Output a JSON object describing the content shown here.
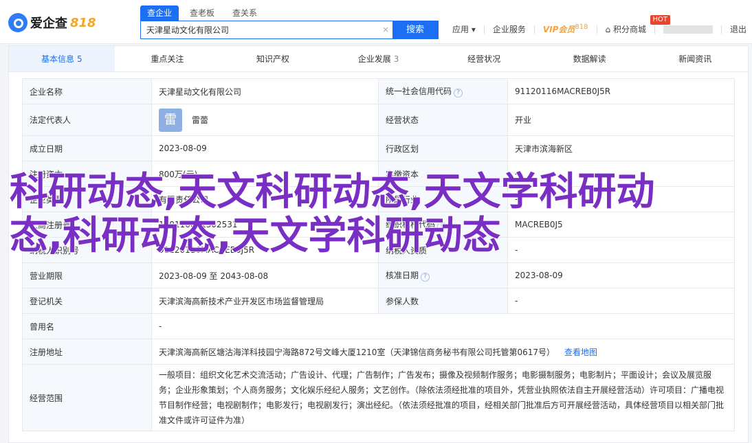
{
  "header": {
    "logo_text": "爱企查",
    "logo_num": "818",
    "search_tabs": [
      "查企业",
      "查老板",
      "查关系"
    ],
    "search_value": "天津星动文化有限公司",
    "search_button": "搜索",
    "nav": {
      "app": "应用",
      "enterprise_service": "企业服务",
      "vip_label": "VIP会员",
      "vip_sub": "818",
      "points_mall": "积分商城",
      "hot_badge": "HOT",
      "logout": "退出"
    }
  },
  "tabs": [
    {
      "label": "基本信息",
      "count": "5"
    },
    {
      "label": "重点关注",
      "count": ""
    },
    {
      "label": "知识产权",
      "count": ""
    },
    {
      "label": "企业发展",
      "count": "3"
    },
    {
      "label": "经营状况",
      "count": ""
    },
    {
      "label": "数据解读",
      "count": ""
    },
    {
      "label": "新闻资讯",
      "count": ""
    }
  ],
  "info": {
    "company_name_label": "企业名称",
    "company_name": "天津星动文化有限公司",
    "credit_code_label": "统一社会信用代码",
    "credit_code": "91120116MACREB0J5R",
    "legal_rep_label": "法定代表人",
    "legal_rep_avatar": "雷",
    "legal_rep": "雷蕾",
    "status_label": "经营状态",
    "status": "开业",
    "found_date_label": "成立日期",
    "found_date": "2023-08-09",
    "region_label": "行政区划",
    "region": "天津市滨海新区",
    "reg_capital_label": "注册资本",
    "reg_capital": "800万(元)",
    "paid_capital_label": "实缴资本",
    "paid_capital": "-",
    "type_label": "企业类型",
    "type": "有限责任公司",
    "industry_label": "所属行业",
    "industry": "-",
    "reg_no_label": "工商注册号",
    "reg_no": "120116001302531",
    "org_code_label": "组织机构代码",
    "org_code": "MACREB0J5",
    "tax_id_label": "纳税人识别号",
    "tax_id": "91120116MACREB0J5R",
    "taxpayer_label": "纳税人资质",
    "taxpayer": "-",
    "term_label": "营业期限",
    "term": "2023-08-09 至 2043-08-08",
    "approve_date_label": "核准日期",
    "approve_date": "2023-08-09",
    "authority_label": "登记机关",
    "authority": "天津滨海高新技术产业开发区市场监督管理局",
    "insured_label": "参保人数",
    "insured": "-",
    "former_name_label": "曾用名",
    "former_name": "-",
    "address_label": "注册地址",
    "address": "天津滨海高新区塘沽海洋科技园宁海路872号文峰大厦1210室（天津锦信商务秘书有限公司托管第0617号）",
    "map_link": "查看地图",
    "scope_label": "经营范围",
    "scope": "一般项目：组织文化艺术交流活动；广告设计、代理；广告制作；广告发布；摄像及视频制作服务；电影摄制服务；电影制片；平面设计；会议及展览服务；企业形象策划；个人商务服务；文化娱乐经纪人服务；文艺创作。（除依法须经批准的项目外，凭营业执照依法自主开展经营活动）许可项目：广播电视节目制作经营；电视剧制作；电影发行；电视剧发行；演出经纪。（依法须经批准的项目，经相关部门批准后方可开展经营活动，具体经营项目以相关部门批准文件或许可证件为准）"
  },
  "overlay_text": "科研动态,天文科研动态,天文学科研动态,科研动态,天文学科研动态",
  "colors": {
    "accent": "#1c6ef2",
    "overlay": "#7a2fc4",
    "label_bg": "#f5f8fc"
  }
}
